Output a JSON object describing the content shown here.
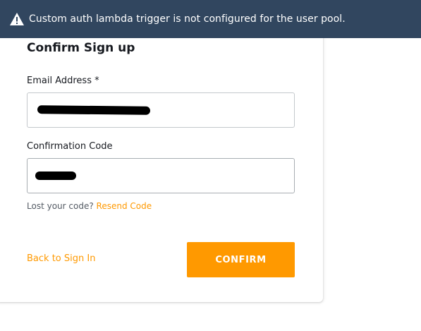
{
  "toast": {
    "icon": "warning-icon",
    "message": "Custom auth lambda trigger is not configured for the user pool."
  },
  "form": {
    "title": "Confirm Sign up",
    "email": {
      "label": "Email Address *",
      "value": ""
    },
    "code": {
      "label": "Confirmation Code",
      "value": ""
    },
    "hint_text": "Lost your code?",
    "resend_label": "Resend Code",
    "back_label": "Back to Sign In",
    "confirm_label": "CONFIRM"
  },
  "colors": {
    "toast_bg": "#31465f",
    "accent": "#ff9900",
    "text": "#16191f"
  }
}
